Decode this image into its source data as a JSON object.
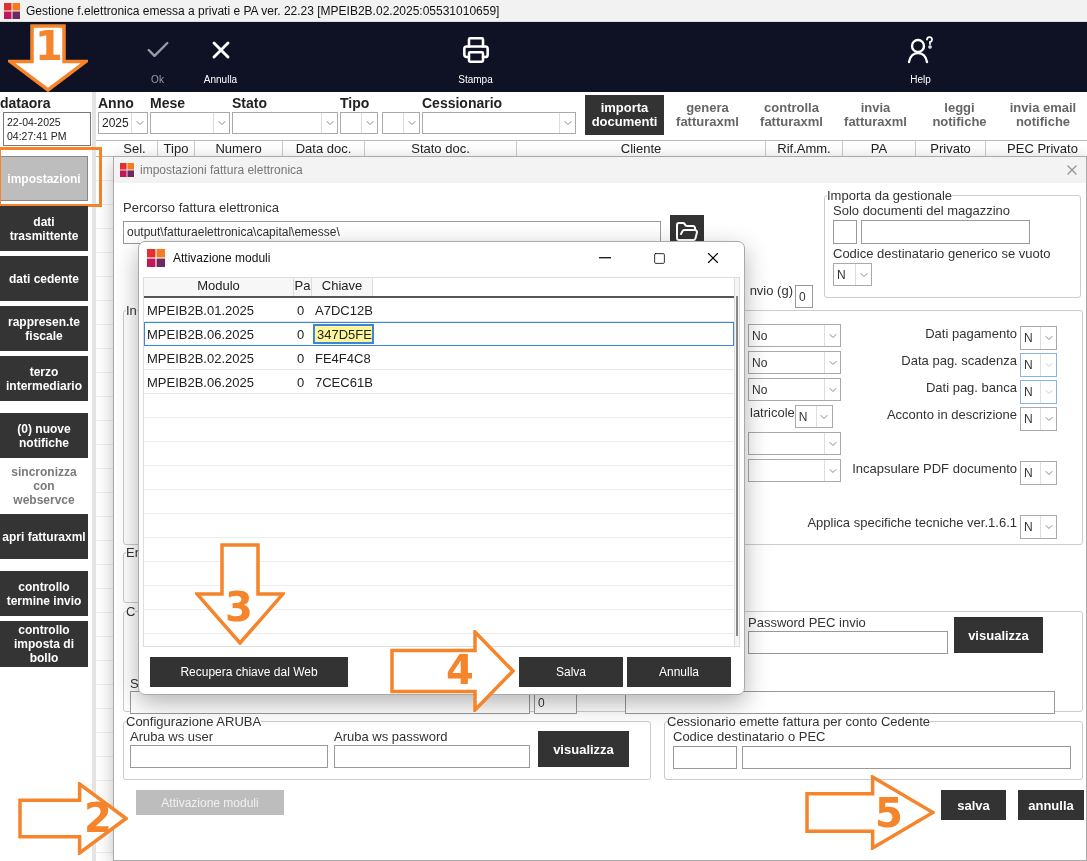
{
  "window": {
    "title": "Gestione f.elettronica emessa a privati e PA  ver. 22.23 [MPEIB2B.02.2025:05531010659]"
  },
  "toolbar": [
    {
      "kind": "ok",
      "label": "Ok",
      "disabled": true
    },
    {
      "kind": "cancel",
      "label": "Annulla",
      "disabled": false
    },
    {
      "kind": "print",
      "label": "Stampa",
      "disabled": false
    },
    {
      "kind": "help",
      "label": "Help",
      "disabled": false
    }
  ],
  "datetime": {
    "label": "dataora",
    "date": "22-04-2025",
    "time": "04:27:41 PM"
  },
  "filters": [
    {
      "label": "Anno",
      "selects": [
        {
          "kind": "year",
          "value": "2025"
        }
      ]
    },
    {
      "label": "Mese",
      "selects": [
        {
          "kind": "month"
        }
      ]
    },
    {
      "label": "Stato",
      "selects": [
        {
          "kind": "state"
        }
      ]
    },
    {
      "label": "Tipo",
      "selects": [
        {
          "kind": "type"
        },
        {
          "kind": "type"
        }
      ]
    },
    {
      "label": "Cessionario",
      "selects": [
        {
          "kind": "client"
        }
      ]
    }
  ],
  "actions": [
    {
      "label": "importa documenti",
      "selected": true
    },
    {
      "label": "genera fatturaxml",
      "selected": false
    },
    {
      "label": "controlla fatturaxml",
      "selected": false
    },
    {
      "label": "invia fatturaxml",
      "selected": false
    },
    {
      "label": "leggi notifiche",
      "selected": false
    },
    {
      "label": "invia email notifiche",
      "selected": false
    }
  ],
  "columns": [
    "Sel.",
    "Tipo",
    "Numero",
    "Data doc.",
    "Stato doc.",
    "Cliente",
    "Rif.Amm.",
    "PA",
    "Privato",
    "PEC Privato"
  ],
  "sidebar": [
    [
      {
        "label": "impostazioni",
        "selected": true,
        "disabled": false,
        "highlighted": true
      },
      {
        "label": "dati trasmittente",
        "selected": false,
        "disabled": false,
        "highlighted": false
      },
      {
        "label": "dati cedente",
        "selected": false,
        "disabled": false,
        "highlighted": false
      },
      {
        "label": "rappresen.te fiscale",
        "selected": false,
        "disabled": false,
        "highlighted": false
      },
      {
        "label": "terzo intermediario",
        "selected": false,
        "disabled": false,
        "highlighted": false
      }
    ],
    [
      {
        "label": "(0) nuove notifiche",
        "selected": false,
        "disabled": false,
        "highlighted": false
      },
      {
        "label": "sincronizza con webservce",
        "selected": false,
        "disabled": true,
        "highlighted": false
      },
      {
        "label": "apri fatturaxml",
        "selected": false,
        "disabled": false,
        "highlighted": false
      }
    ],
    [
      {
        "label": "controllo termine invio",
        "selected": false,
        "disabled": false,
        "highlighted": false
      },
      {
        "label": "controllo imposta di bollo",
        "selected": false,
        "disabled": false,
        "highlighted": false
      }
    ]
  ],
  "settings": {
    "title": "impostazioni fattura elettronica",
    "path": {
      "label": "Percorso fattura elettronica",
      "value": "output\\fatturaelettronica\\capital\\emesse\\"
    },
    "send_days": {
      "label": "nvio (g)",
      "value": "0"
    },
    "import": {
      "legend": "Importa da gestionale",
      "warehouse_label": "Solo documenti del magazzino",
      "generic_code_label": "Codice destinatario generico se vuoto",
      "generic_code_value": "N"
    },
    "options": {
      "legend": "In",
      "rows": [
        {
          "left": {
            "kind": "select",
            "value": "No"
          },
          "right": {
            "label": "Dati pagamento",
            "value": "N",
            "disabled": false
          }
        },
        {
          "left": {
            "kind": "select",
            "value": "No"
          },
          "right": {
            "label": "Data pag. scadenza",
            "value": "N",
            "disabled": true
          }
        },
        {
          "left": {
            "kind": "select",
            "value": "No"
          },
          "right": {
            "label": "Dati pag. banca",
            "value": "N",
            "disabled": true
          }
        },
        {
          "left": {
            "kind": "labeled",
            "label": "latricole",
            "value": "N"
          },
          "right": {
            "label": "Acconto in descrizione",
            "value": "N",
            "disabled": false
          }
        },
        {
          "left": {
            "kind": "select"
          }
        },
        {
          "left": {
            "kind": "select"
          },
          "right": {
            "label": "Incapsulare PDF documento",
            "value": "N",
            "disabled": false
          }
        }
      ],
      "wide": {
        "label": "Applica specifiche tecniche ver.1.6.1",
        "value": "N",
        "disabled": false
      }
    },
    "group_e": {
      "legend": "Er"
    },
    "group_c": {
      "legend": "C",
      "side_label": "S",
      "password_label": "Password PEC invio",
      "show_button": "visualizza",
      "small_value": "0"
    },
    "aruba": {
      "legend": "Configurazione ARUBA",
      "user_label": "Aruba ws user",
      "password_label": "Aruba ws password",
      "show_button": "visualizza"
    },
    "assignee": {
      "legend": "Cessionario emette fattura per conto Cedente",
      "code_label": "Codice destinatario o PEC"
    },
    "modules_button": {
      "label": "Attivazione moduli",
      "disabled": true
    },
    "buttons": [
      "salva",
      "annulla"
    ]
  },
  "modules": {
    "title": "Attivazione moduli",
    "columns": [
      "Modulo",
      "Pa",
      "Chiave"
    ],
    "rows": [
      {
        "module": "MPEIB2B.01.2025",
        "pa": "0",
        "key": "A7DC12B",
        "selected": false
      },
      {
        "module": "MPEIB2B.06.2025",
        "pa": "0",
        "key": "347D5FE",
        "selected": true
      },
      {
        "module": "MPEIB2B.02.2025",
        "pa": "0",
        "key": "FE4F4C8",
        "selected": false
      },
      {
        "module": "MPEIB2B.06.2025",
        "pa": "0",
        "key": "7CEC61B",
        "selected": false
      }
    ],
    "fetch_button": "Recupera chiave dal Web",
    "buttons": [
      "Salva",
      "Annulla"
    ]
  },
  "annotations": [
    {
      "number": "1",
      "kind": "down"
    },
    {
      "number": "2",
      "kind": "right"
    },
    {
      "number": "3",
      "kind": "down"
    },
    {
      "number": "4",
      "kind": "right"
    },
    {
      "number": "5",
      "kind": "right"
    }
  ]
}
